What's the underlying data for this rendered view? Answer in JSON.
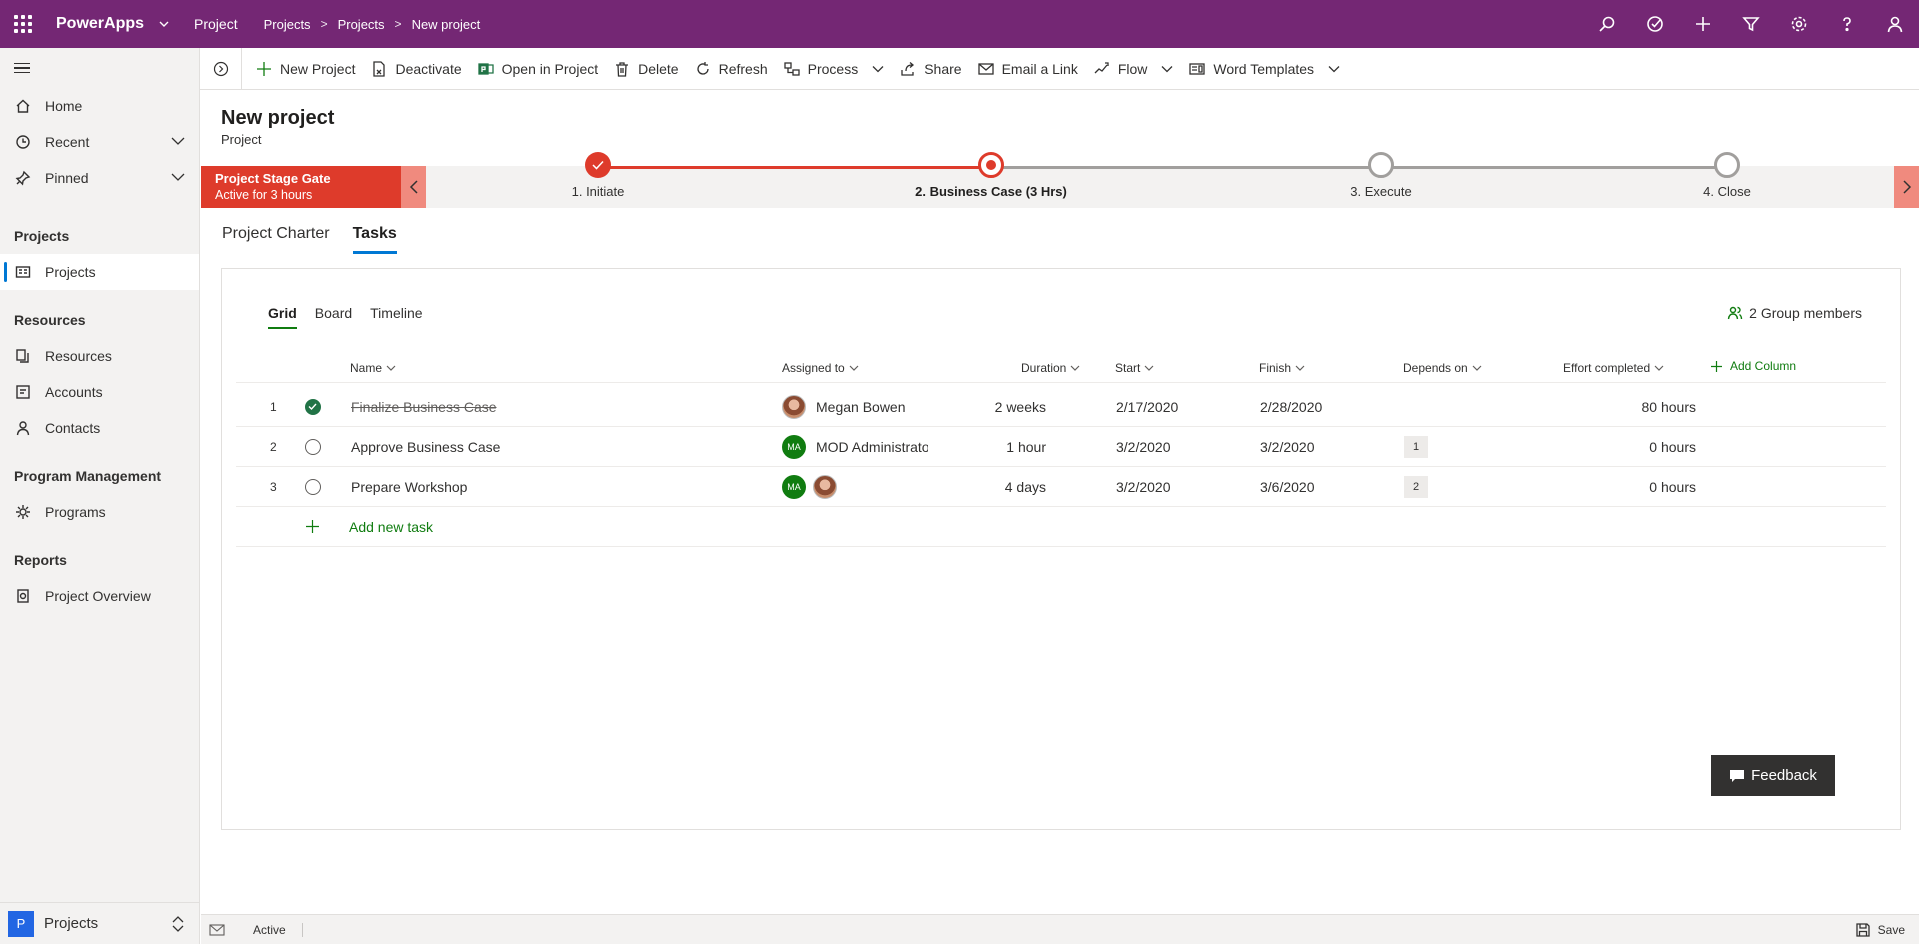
{
  "topbar": {
    "app_name": "PowerApps",
    "entity": "Project",
    "breadcrumbs": [
      "Projects",
      "Projects",
      "New project"
    ]
  },
  "sidebar": {
    "top_items": [
      {
        "label": "Home",
        "icon": "home-icon"
      },
      {
        "label": "Recent",
        "icon": "clock-icon"
      },
      {
        "label": "Pinned",
        "icon": "pin-icon"
      }
    ],
    "groups": [
      {
        "title": "Projects",
        "items": [
          {
            "label": "Projects",
            "icon": "projects-icon",
            "selected": true
          }
        ]
      },
      {
        "title": "Resources",
        "items": [
          {
            "label": "Resources"
          },
          {
            "label": "Accounts"
          },
          {
            "label": "Contacts"
          }
        ]
      },
      {
        "title": "Program Management",
        "items": [
          {
            "label": "Programs"
          }
        ]
      },
      {
        "title": "Reports",
        "items": [
          {
            "label": "Project Overview"
          }
        ]
      }
    ],
    "area": {
      "badge": "P",
      "label": "Projects"
    }
  },
  "commands": [
    "New Project",
    "Deactivate",
    "Open in Project",
    "Delete",
    "Refresh",
    "Process",
    "Share",
    "Email a Link",
    "Flow",
    "Word Templates"
  ],
  "form": {
    "title": "New project",
    "subtitle": "Project"
  },
  "bpf": {
    "name": "Project Stage Gate",
    "duration": "Active for 3 hours",
    "stages": [
      "1. Initiate",
      "2. Business Case  (3 Hrs)",
      "3. Execute",
      "4. Close"
    ],
    "active_stage": 2,
    "accent": "#de3b2b"
  },
  "tabs": [
    "Project Charter",
    "Tasks"
  ],
  "active_tab": "Tasks",
  "tasks": {
    "views": [
      "Grid",
      "Board",
      "Timeline"
    ],
    "group_members": "2 Group members",
    "columns": {
      "name": "Name",
      "assigned": "Assigned to",
      "duration": "Duration",
      "start": "Start",
      "finish": "Finish",
      "depends": "Depends on",
      "effort": "Effort completed",
      "add": "Add Column"
    },
    "rows": [
      {
        "num": "1",
        "name": "Finalize Business Case",
        "assigned": "Megan Bowen",
        "duration": "2 weeks",
        "start": "2/17/2020",
        "finish": "2/28/2020",
        "depends": "",
        "effort": "80 hours",
        "done": true
      },
      {
        "num": "2",
        "name": "Approve Business Case",
        "assigned": "MOD Administrator",
        "duration": "1 hour",
        "start": "3/2/2020",
        "finish": "3/2/2020",
        "depends": "1",
        "effort": "0 hours",
        "done": false
      },
      {
        "num": "3",
        "name": "Prepare Workshop",
        "assigned": "",
        "duration": "4 days",
        "start": "3/2/2020",
        "finish": "3/6/2020",
        "depends": "2",
        "effort": "0 hours",
        "done": false
      }
    ],
    "initials": "MA",
    "add_task": "Add new task"
  },
  "feedback": "Feedback",
  "status": {
    "state": "Active",
    "save": "Save"
  },
  "colors": {
    "brand": "#742774",
    "green": "#107c10",
    "blue": "#0078d4"
  }
}
